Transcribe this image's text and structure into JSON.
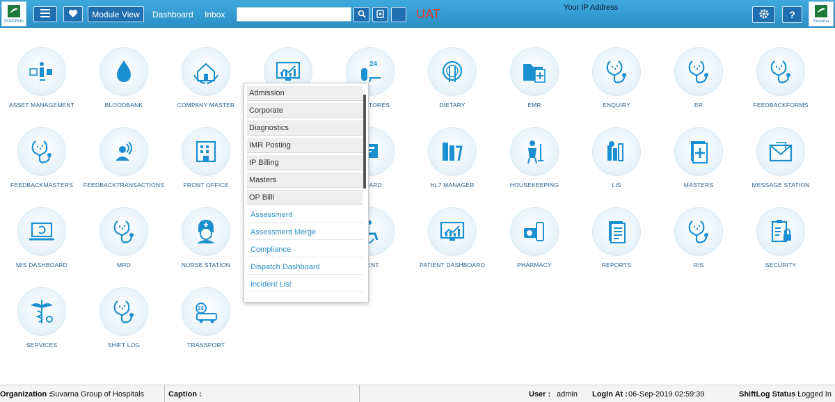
{
  "header": {
    "logo_text": "SUVARNA",
    "logo_text_right": "Suvarna",
    "module_view": "Module View",
    "dashboard": "Dashboard",
    "inbox": "Inbox",
    "search_value": "",
    "environment": "UAT",
    "ip_label": "Your IP Address",
    "accent_color": "#2a8fc6"
  },
  "modules": [
    {
      "label": "ASSET MANAGEMENT",
      "icon": "asset-management-icon"
    },
    {
      "label": "BLOODBANK",
      "icon": "blood-drop-icon"
    },
    {
      "label": "COMPANY MASTER",
      "icon": "company-master-icon"
    },
    {
      "label": "",
      "icon": "chart-monitor-icon"
    },
    {
      "label": "ENT STORES",
      "icon": "stores-24hrs-icon"
    },
    {
      "label": "DIETARY",
      "icon": "dietary-icon"
    },
    {
      "label": "EMR",
      "icon": "emr-folder-icon"
    },
    {
      "label": "ENQUIRY",
      "icon": "stethoscope-icon"
    },
    {
      "label": "ER",
      "icon": "stethoscope-icon"
    },
    {
      "label": "FEEDBACKFORMS",
      "icon": "stethoscope-icon"
    },
    {
      "label": "FEEDBACKMASTERS",
      "icon": "stethoscope-icon"
    },
    {
      "label": "FEEDBACKTRANSACTIONS",
      "icon": "person-signal-icon"
    },
    {
      "label": "FRONT OFFICE",
      "icon": "building-icon"
    },
    {
      "label": "",
      "icon": "cards-icon"
    },
    {
      "label": "H CARD",
      "icon": "cards-icon"
    },
    {
      "label": "HL7 MANAGER",
      "icon": "hl7-icon"
    },
    {
      "label": "HOUSEKEEPING",
      "icon": "housekeeping-icon"
    },
    {
      "label": "LIS",
      "icon": "lis-icon"
    },
    {
      "label": "MASTERS",
      "icon": "masters-book-icon"
    },
    {
      "label": "MESSAGE STATION",
      "icon": "envelope-icon"
    },
    {
      "label": "MIS DASHBOARD",
      "icon": "laptop-icon"
    },
    {
      "label": "MRD",
      "icon": "stethoscope-icon"
    },
    {
      "label": "NURSE STATION",
      "icon": "nurse-icon"
    },
    {
      "label": "",
      "icon": "blank-icon"
    },
    {
      "label": "TIENT",
      "icon": "wheelchair-icon"
    },
    {
      "label": "PATIENT DASHBOARD",
      "icon": "chart-monitor-icon"
    },
    {
      "label": "PHARMACY",
      "icon": "pharmacy-icon"
    },
    {
      "label": "REPORTS",
      "icon": "reports-icon"
    },
    {
      "label": "RIS",
      "icon": "stethoscope-icon"
    },
    {
      "label": "SECURITY",
      "icon": "security-icon"
    },
    {
      "label": "SERVICES",
      "icon": "caduceus-icon"
    },
    {
      "label": "SHIFT LOG",
      "icon": "stethoscope-icon"
    },
    {
      "label": "TRANSPORT",
      "icon": "ambulance-24-icon"
    }
  ],
  "dropdown": {
    "items": [
      {
        "label": "Admission",
        "type": "group"
      },
      {
        "label": "Corporate",
        "type": "group"
      },
      {
        "label": "Diagnostics",
        "type": "group"
      },
      {
        "label": "IMR Posting",
        "type": "group"
      },
      {
        "label": "IP Billing",
        "type": "group"
      },
      {
        "label": "Masters",
        "type": "group"
      },
      {
        "label": "OP Billi",
        "type": "group"
      },
      {
        "label": "Assessment",
        "type": "link"
      },
      {
        "label": "Assessment Merge",
        "type": "link"
      },
      {
        "label": "Compliance",
        "type": "link"
      },
      {
        "label": "Dispatch Dashboard",
        "type": "link"
      },
      {
        "label": "Incident List",
        "type": "link"
      }
    ]
  },
  "status": {
    "org_label": "Organization :",
    "org_value": "Suvarna Group of Hospitals",
    "caption_label": "Caption :",
    "user_label": "User :",
    "user_value": "admin",
    "login_label": "LogIn At :",
    "login_value": "06-Sep-2019 02:59:39",
    "shiftlog_label": "ShiftLog Status :",
    "shiftlog_value": "Logged In"
  }
}
